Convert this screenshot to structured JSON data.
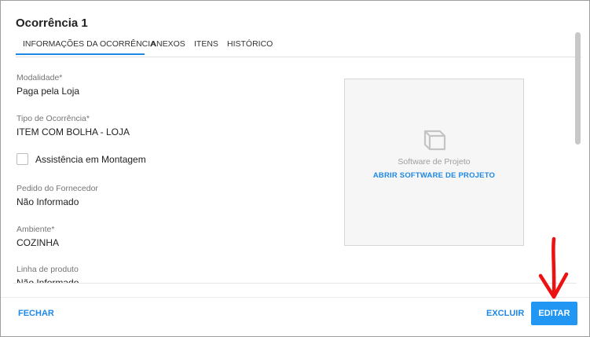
{
  "dialog": {
    "title": "Ocorrência 1"
  },
  "tabs": [
    {
      "label": "INFORMAÇÕES DA OCORRÊNCIA",
      "active": true
    },
    {
      "label": "ANEXOS",
      "active": false
    },
    {
      "label": "ITENS",
      "active": false
    },
    {
      "label": "HISTÓRICO",
      "active": false
    }
  ],
  "fields": {
    "modalidade": {
      "label": "Modalidade*",
      "value": "Paga pela Loja"
    },
    "tipo": {
      "label": "Tipo de Ocorrência*",
      "value": "ITEM COM BOLHA - LOJA"
    },
    "assistencia": {
      "label": "Assistência em Montagem",
      "checked": false
    },
    "pedido": {
      "label": "Pedido do Fornecedor",
      "value": "Não Informado"
    },
    "ambiente": {
      "label": "Ambiente*",
      "value": "COZINHA"
    },
    "linha": {
      "label": "Linha de produto",
      "value": "Não Informado"
    }
  },
  "project_panel": {
    "icon": "cube-icon",
    "caption": "Software de Projeto",
    "link": "ABRIR SOFTWARE DE PROJETO"
  },
  "footer": {
    "close_label": "FECHAR",
    "delete_label": "EXCLUIR",
    "edit_label": "EDITAR"
  },
  "colors": {
    "accent": "#1e88e5",
    "primary_button": "#2196f3",
    "annotation_arrow": "#ee1111"
  }
}
